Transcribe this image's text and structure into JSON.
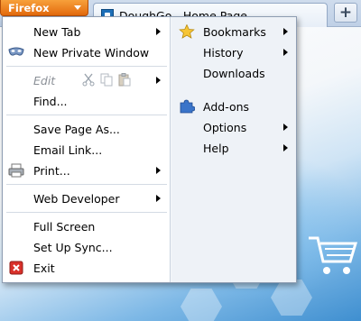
{
  "browser": {
    "menu_button_label": "Firefox",
    "tab_title": "DoughGo - Home Page",
    "new_tab_symbol": "+"
  },
  "menu": {
    "left": [
      {
        "label": "New Tab",
        "submenu": true
      },
      {
        "label": "New Private Window",
        "icon": "private-mask-icon"
      },
      {
        "label": "Edit",
        "submenu": true,
        "disabled": true,
        "tools": [
          "cut-icon",
          "copy-icon",
          "paste-icon"
        ]
      },
      {
        "label": "Find..."
      },
      {
        "label": "Save Page As..."
      },
      {
        "label": "Email Link..."
      },
      {
        "label": "Print...",
        "submenu": true,
        "icon": "printer-icon"
      },
      {
        "label": "Web Developer",
        "submenu": true
      },
      {
        "label": "Full Screen"
      },
      {
        "label": "Set Up Sync..."
      },
      {
        "label": "Exit",
        "icon": "exit-icon"
      }
    ],
    "right": [
      {
        "label": "Bookmarks",
        "submenu": true,
        "icon": "star-icon"
      },
      {
        "label": "History",
        "submenu": true
      },
      {
        "label": "Downloads"
      },
      {
        "label": "Add-ons",
        "icon": "puzzle-piece-icon"
      },
      {
        "label": "Options",
        "submenu": true
      },
      {
        "label": "Help",
        "submenu": true
      }
    ]
  },
  "colors": {
    "firefox_button": "#e36a0d",
    "menu_left_bg": "#ffffff",
    "menu_right_bg": "#eef2f7"
  }
}
